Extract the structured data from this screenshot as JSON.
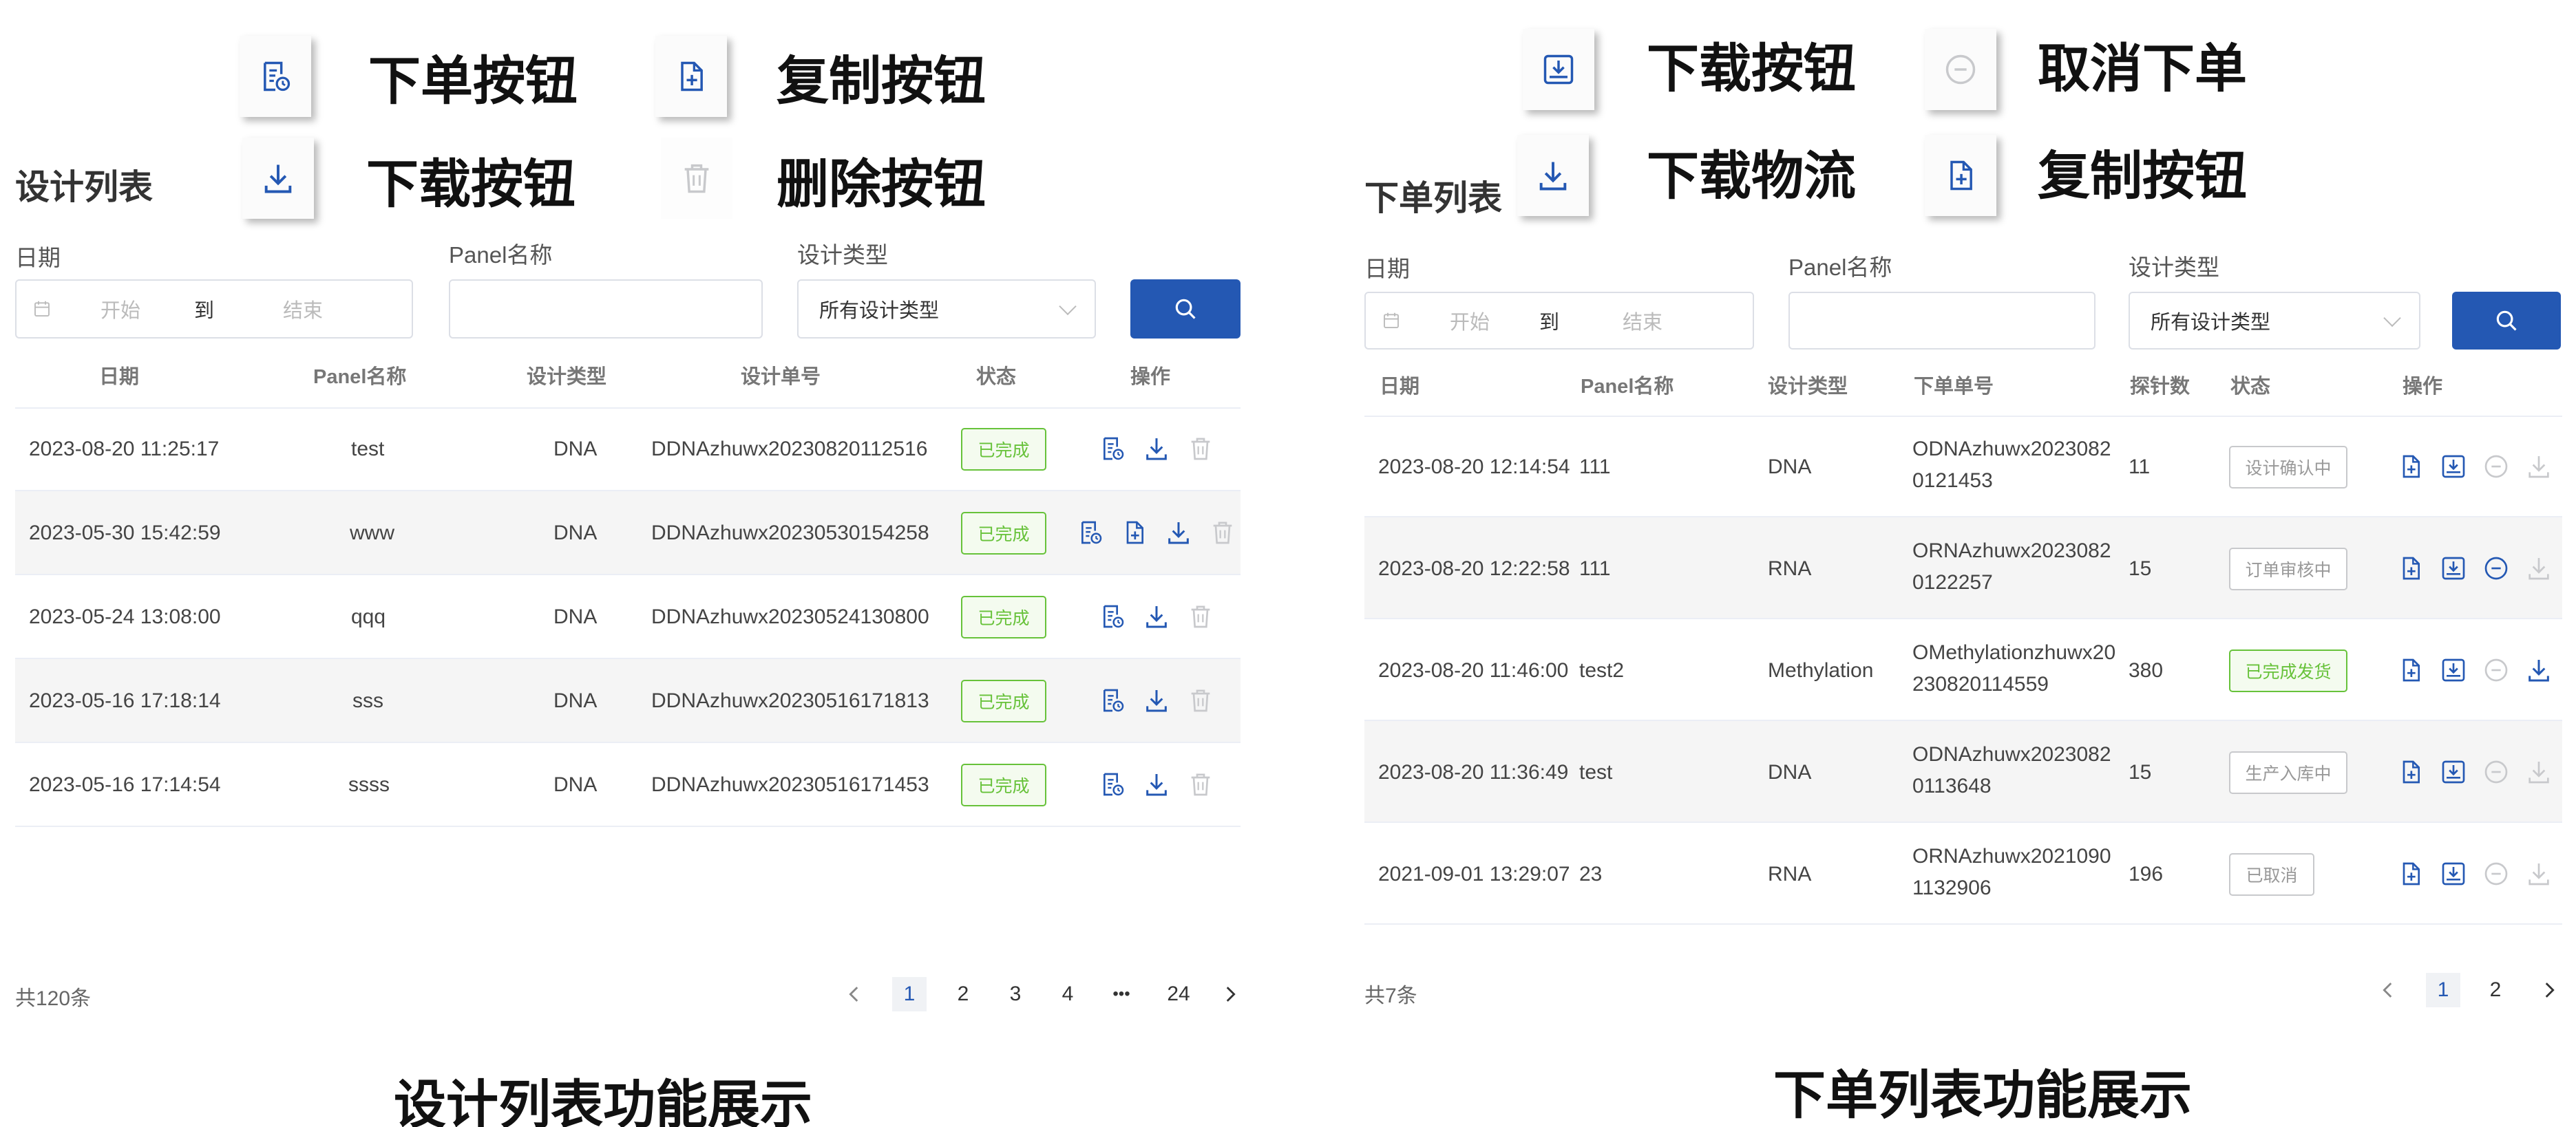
{
  "colors": {
    "accent": "#2458b3",
    "success": "#67c23a",
    "muted": "#c8c9cc"
  },
  "left": {
    "legend": [
      {
        "icon": "order-doc-icon",
        "label": "下单按钮"
      },
      {
        "icon": "copy-file-icon",
        "label": "复制按钮"
      },
      {
        "icon": "download-icon",
        "label": "下载按钮"
      },
      {
        "icon": "trash-icon",
        "label": "删除按钮"
      }
    ],
    "title": "设计列表",
    "filters": {
      "date_label": "日期",
      "date_start": "开始",
      "date_to": "到",
      "date_end": "结束",
      "panel_label": "Panel名称",
      "panel_value": "",
      "type_label": "设计类型",
      "type_value": "所有设计类型"
    },
    "columns": [
      "日期",
      "Panel名称",
      "设计类型",
      "设计单号",
      "状态",
      "操作"
    ],
    "rows": [
      {
        "date": "2023-08-20 11:25:17",
        "panel": "test",
        "type": "DNA",
        "number": "DDNAzhuwx20230820112516",
        "status": "已完成"
      },
      {
        "date": "2023-05-30 15:42:59",
        "panel": "www",
        "type": "DNA",
        "number": "DDNAzhuwx20230530154258",
        "status": "已完成"
      },
      {
        "date": "2023-05-24 13:08:00",
        "panel": "qqq",
        "type": "DNA",
        "number": "DDNAzhuwx20230524130800",
        "status": "已完成"
      },
      {
        "date": "2023-05-16 17:18:14",
        "panel": "sss",
        "type": "DNA",
        "number": "DDNAzhuwx20230516171813",
        "status": "已完成"
      },
      {
        "date": "2023-05-16 17:14:54",
        "panel": "ssss",
        "type": "DNA",
        "number": "DDNAzhuwx20230516171453",
        "status": "已完成"
      }
    ],
    "total": "共120条",
    "pages": [
      "1",
      "2",
      "3",
      "4",
      "•••",
      "24"
    ],
    "caption": "设计列表功能展示"
  },
  "right": {
    "legend": [
      {
        "icon": "download-tray-icon",
        "label": "下载按钮"
      },
      {
        "icon": "cancel-circle-icon",
        "label": "取消下单"
      },
      {
        "icon": "download-icon",
        "label": "下载物流"
      },
      {
        "icon": "copy-file-icon",
        "label": "复制按钮"
      }
    ],
    "title": "下单列表",
    "filters": {
      "date_label": "日期",
      "date_start": "开始",
      "date_to": "到",
      "date_end": "结束",
      "panel_label": "Panel名称",
      "panel_value": "",
      "type_label": "设计类型",
      "type_value": "所有设计类型"
    },
    "columns": [
      "日期",
      "Panel名称",
      "设计类型",
      "下单单号",
      "探针数",
      "状态",
      "操作"
    ],
    "rows": [
      {
        "date": "2023-08-20 12:14:54",
        "panel": "111",
        "type": "DNA",
        "number_line1": "ODNAzhuwx2023082",
        "number_line2": "0121453",
        "probes": "11",
        "status": "设计确认中"
      },
      {
        "date": "2023-08-20 12:22:58",
        "panel": "111",
        "type": "RNA",
        "number_line1": "ORNAzhuwx2023082",
        "number_line2": "0122257",
        "probes": "15",
        "status": "订单审核中"
      },
      {
        "date": "2023-08-20 11:46:00",
        "panel": "test2",
        "type": "Methylation",
        "number_line1": "OMethylationzhuwx20",
        "number_line2": "230820114559",
        "probes": "380",
        "status": "已完成发货"
      },
      {
        "date": "2023-08-20 11:36:49",
        "panel": "test",
        "type": "DNA",
        "number_line1": "ODNAzhuwx2023082",
        "number_line2": "0113648",
        "probes": "15",
        "status": "生产入库中"
      },
      {
        "date": "2021-09-01 13:29:07",
        "panel": "23",
        "type": "RNA",
        "number_line1": "ORNAzhuwx2021090",
        "number_line2": "1132906",
        "probes": "196",
        "status": "已取消"
      }
    ],
    "total": "共7条",
    "pages": [
      "1",
      "2"
    ],
    "caption": "下单列表功能展示"
  }
}
